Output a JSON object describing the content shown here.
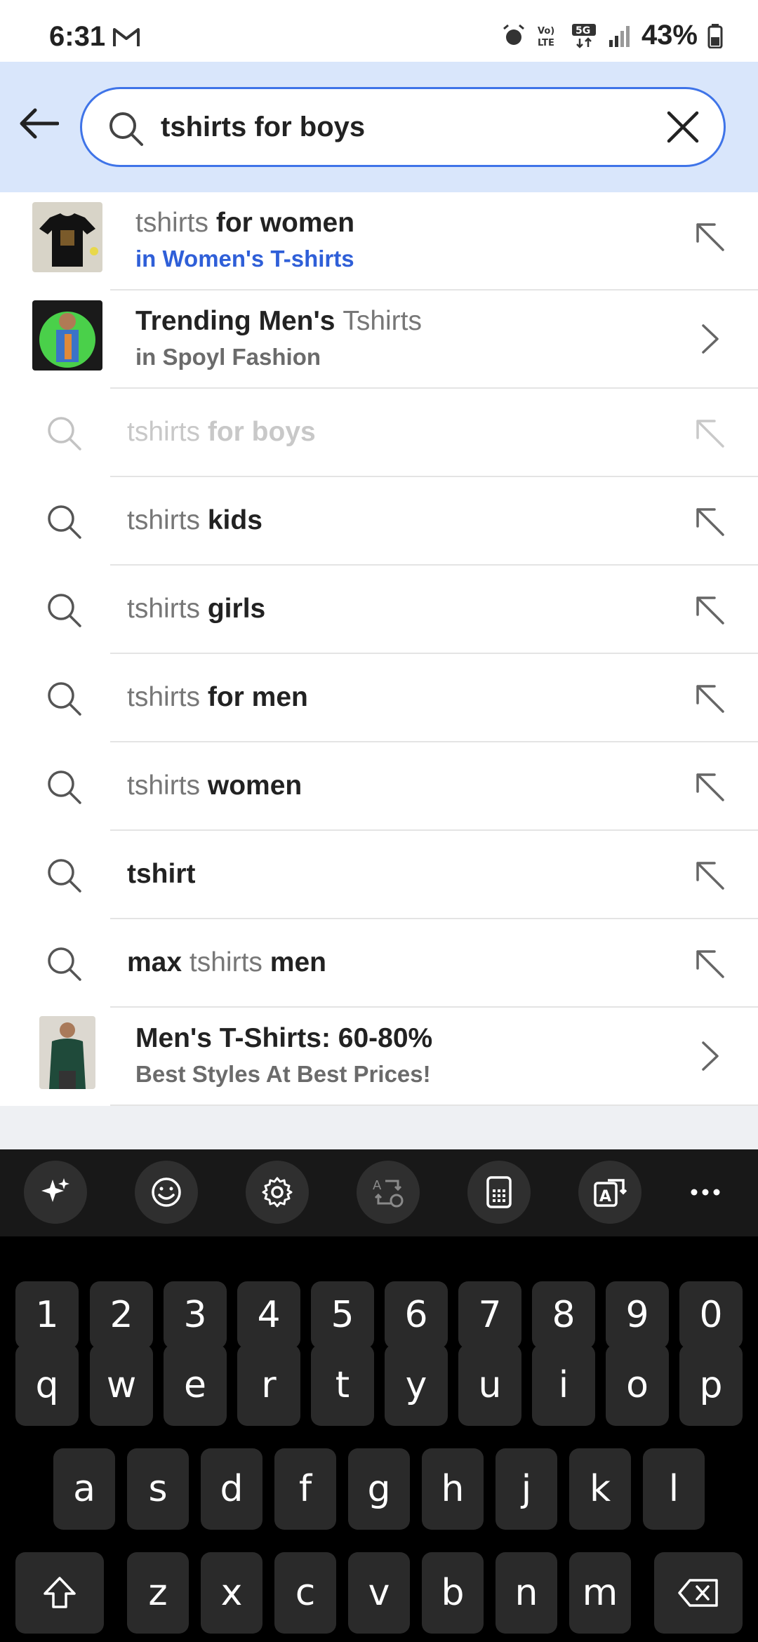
{
  "status_bar": {
    "time": "6:31",
    "battery": "43%",
    "icons": [
      "gmail-icon",
      "alarm-icon",
      "volte-icon",
      "5g-icon",
      "signal-icon",
      "battery-icon"
    ]
  },
  "search": {
    "query": "tshirts for boys"
  },
  "suggestions": [
    {
      "type": "category",
      "light": "tshirts ",
      "bold": "for women",
      "sub": "in Women's T-shirts",
      "sub_color": "#2f5fd8"
    },
    {
      "type": "promo",
      "bold": "Trending Men's ",
      "light": "Tshirts",
      "sub": "in Spoyl Fashion"
    },
    {
      "type": "query",
      "faded": true,
      "light": "tshirts ",
      "bold": "for boys"
    },
    {
      "type": "query",
      "light": "tshirts ",
      "bold": "kids"
    },
    {
      "type": "query",
      "light": "tshirts ",
      "bold": "girls"
    },
    {
      "type": "query",
      "light": "tshirts ",
      "bold": "for men"
    },
    {
      "type": "query",
      "light": "tshirts ",
      "bold": "women"
    },
    {
      "type": "query",
      "bold": "tshirt"
    },
    {
      "type": "query",
      "bold": "max ",
      "light": "tshirts ",
      "bold2": "men"
    },
    {
      "type": "promo",
      "title": "Men's T-Shirts: 60-80%",
      "sub": "Best Styles At Best Prices!"
    }
  ],
  "keyboard": {
    "toolbar": [
      "sparkle-icon",
      "emoji-icon",
      "settings-icon",
      "translate-icon",
      "keypad-icon",
      "text-recognition-icon",
      "more-icon"
    ],
    "row_numbers": [
      "1",
      "2",
      "3",
      "4",
      "5",
      "6",
      "7",
      "8",
      "9",
      "0"
    ],
    "row1": [
      "q",
      "w",
      "e",
      "r",
      "t",
      "y",
      "u",
      "i",
      "o",
      "p"
    ],
    "row2": [
      "a",
      "s",
      "d",
      "f",
      "g",
      "h",
      "j",
      "k",
      "l"
    ],
    "row3": [
      "z",
      "x",
      "c",
      "v",
      "b",
      "n",
      "m"
    ]
  }
}
